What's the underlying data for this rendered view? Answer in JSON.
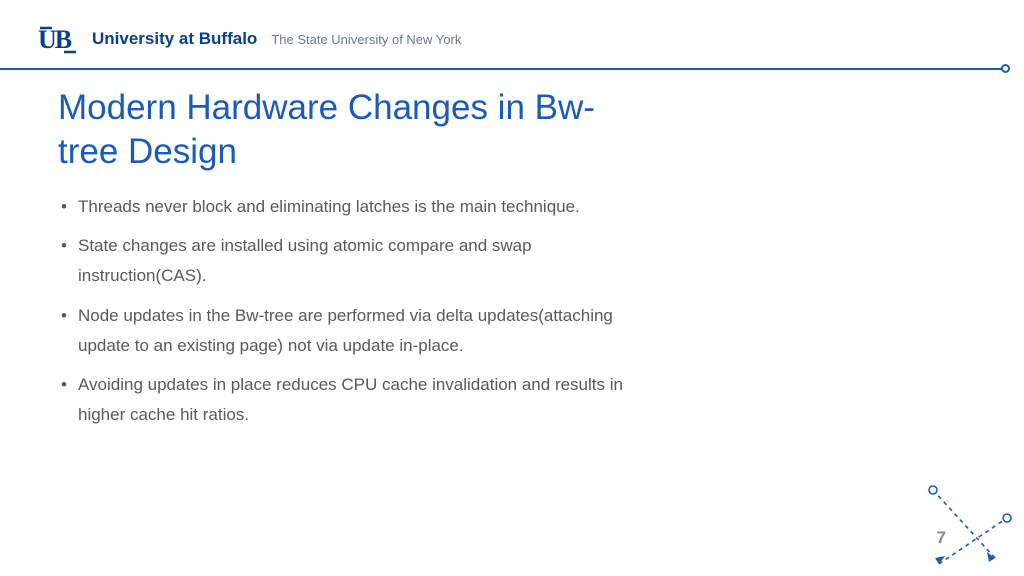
{
  "header": {
    "university_name": "University at Buffalo",
    "tagline": "The State University of New York"
  },
  "slide": {
    "title": "Modern Hardware Changes in Bw-tree Design",
    "bullets": [
      "Threads never block and eliminating latches is the main technique.",
      "State changes are installed using atomic compare and swap instruction(CAS).",
      "Node updates in the Bw-tree are performed via delta updates(attaching update to an existing page) not via update in-place.",
      "Avoiding updates in place reduces CPU cache invalidation and results in higher cache hit ratios."
    ],
    "page_number": "7"
  }
}
